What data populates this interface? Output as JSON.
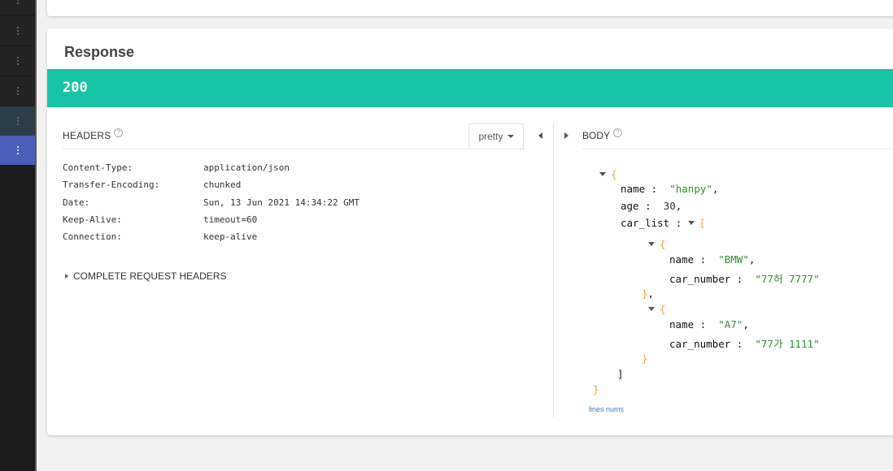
{
  "response": {
    "title": "Response",
    "status_code": "200",
    "status_color": "#18c4a6"
  },
  "headers_pane": {
    "title": "HEADERS",
    "format_label": "pretty",
    "rows": [
      {
        "key": "Content-Type:",
        "value": "application/json"
      },
      {
        "key": "Transfer-Encoding:",
        "value": "chunked"
      },
      {
        "key": "Date:",
        "value": "Sun, 13 Jun 2021 14:34:22 GMT"
      },
      {
        "key": "Keep-Alive:",
        "value": "timeout=60"
      },
      {
        "key": "Connection:",
        "value": "keep-alive"
      }
    ],
    "complete_request_headers": "COMPLETE REQUEST HEADERS"
  },
  "body_pane": {
    "title": "BODY",
    "json": {
      "name_key": "name",
      "name_val": "\"hanpy\"",
      "age_key": "age",
      "age_val": "30",
      "car_list_key": "car_list",
      "cars": [
        {
          "name_key": "name",
          "name_val": "\"BMW\"",
          "num_key": "car_number",
          "num_val": "\"77허 7777\""
        },
        {
          "name_key": "name",
          "name_val": "\"A7\"",
          "num_key": "car_number",
          "num_val": "\"77가 1111\""
        }
      ]
    },
    "lines_nums_label": "lines nums"
  }
}
